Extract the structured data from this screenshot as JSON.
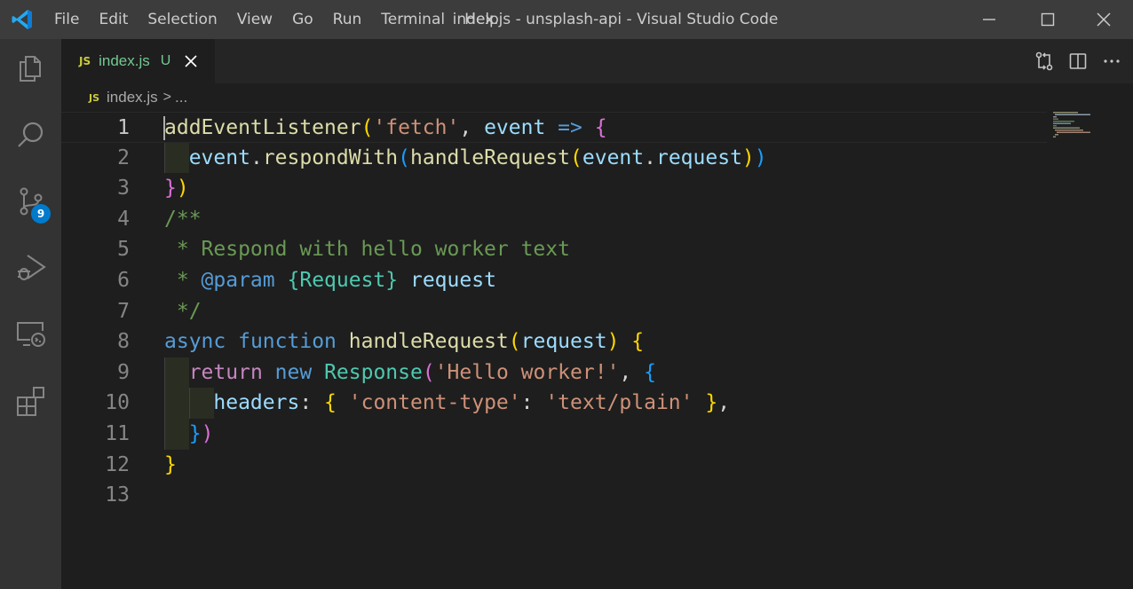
{
  "titlebar": {
    "menu": [
      "File",
      "Edit",
      "Selection",
      "View",
      "Go",
      "Run",
      "Terminal",
      "Help"
    ],
    "title": "index.js - unsplash-api - Visual Studio Code"
  },
  "activity_bar": {
    "items": [
      "explorer-icon",
      "search-icon",
      "source-control-icon",
      "run-debug-icon",
      "remote-explorer-icon",
      "extensions-icon"
    ],
    "scm_badge": "9"
  },
  "tab": {
    "icon_text": "JS",
    "label": "index.js",
    "status": "U"
  },
  "breadcrumb": {
    "icon_text": "JS",
    "file": "index.js",
    "separator": ">",
    "rest": "..."
  },
  "editor": {
    "line_numbers": [
      "1",
      "2",
      "3",
      "4",
      "5",
      "6",
      "7",
      "8",
      "9",
      "10",
      "11",
      "12",
      "13"
    ],
    "active_line": "1",
    "lines": [
      [
        [
          "addEventListener",
          "fn"
        ],
        [
          "(",
          "b1"
        ],
        [
          "'fetch'",
          "str"
        ],
        [
          ", ",
          "pun"
        ],
        [
          "event",
          "var"
        ],
        [
          " ",
          "pun"
        ],
        [
          "=>",
          "kw"
        ],
        [
          " ",
          "pun"
        ],
        [
          "{",
          "b2"
        ]
      ],
      [
        [
          "  ",
          "pun"
        ],
        [
          "event",
          "var"
        ],
        [
          ".",
          "pun"
        ],
        [
          "respondWith",
          "fn"
        ],
        [
          "(",
          "b3"
        ],
        [
          "handleRequest",
          "fn"
        ],
        [
          "(",
          "b1"
        ],
        [
          "event",
          "var"
        ],
        [
          ".",
          "pun"
        ],
        [
          "request",
          "var"
        ],
        [
          ")",
          "b1"
        ],
        [
          ")",
          "b3"
        ]
      ],
      [
        [
          "}",
          "b2"
        ],
        [
          ")",
          "b1"
        ]
      ],
      [
        [
          "/**",
          "com"
        ]
      ],
      [
        [
          " * Respond with hello worker text",
          "com"
        ]
      ],
      [
        [
          " * ",
          "com"
        ],
        [
          "@param",
          "kw"
        ],
        [
          " ",
          "com"
        ],
        [
          "{Request}",
          "cls"
        ],
        [
          " ",
          "com"
        ],
        [
          "request",
          "var"
        ]
      ],
      [
        [
          " */",
          "com"
        ]
      ],
      [
        [
          "async",
          "kw"
        ],
        [
          " ",
          "pun"
        ],
        [
          "function",
          "kw"
        ],
        [
          " ",
          "pun"
        ],
        [
          "handleRequest",
          "fn"
        ],
        [
          "(",
          "b1"
        ],
        [
          "request",
          "var"
        ],
        [
          ")",
          "b1"
        ],
        [
          " ",
          "pun"
        ],
        [
          "{",
          "b1"
        ]
      ],
      [
        [
          "  ",
          "pun"
        ],
        [
          "return",
          "ctl"
        ],
        [
          " ",
          "pun"
        ],
        [
          "new",
          "kw"
        ],
        [
          " ",
          "pun"
        ],
        [
          "Response",
          "cls"
        ],
        [
          "(",
          "b2"
        ],
        [
          "'Hello worker!'",
          "str"
        ],
        [
          ", ",
          "pun"
        ],
        [
          "{",
          "b3"
        ]
      ],
      [
        [
          "    ",
          "pun"
        ],
        [
          "headers",
          "var"
        ],
        [
          ": ",
          "pun"
        ],
        [
          "{",
          "b1"
        ],
        [
          " ",
          "pun"
        ],
        [
          "'content-type'",
          "str"
        ],
        [
          ": ",
          "pun"
        ],
        [
          "'text/plain'",
          "str"
        ],
        [
          " ",
          "pun"
        ],
        [
          "}",
          "b1"
        ],
        [
          ",",
          "pun"
        ]
      ],
      [
        [
          "  ",
          "pun"
        ],
        [
          "}",
          "b3"
        ],
        [
          ")",
          "b2"
        ]
      ],
      [
        [
          "}",
          "b1"
        ]
      ],
      []
    ]
  },
  "colors": {
    "titlebar_bg": "#3c3c3c",
    "activity_bg": "#333333",
    "editor_bg": "#1e1e1e",
    "tab_untracked": "#73c991",
    "badge": "#007acc"
  }
}
